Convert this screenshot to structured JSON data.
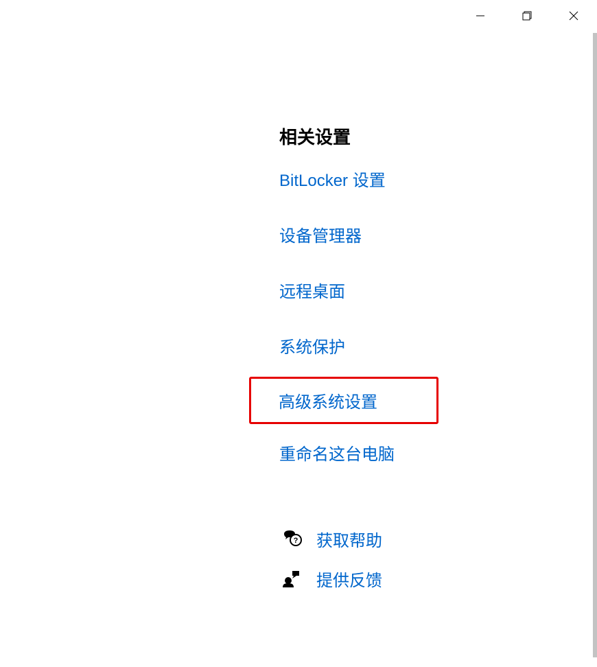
{
  "section": {
    "title": "相关设置",
    "links": [
      {
        "label": "BitLocker 设置"
      },
      {
        "label": "设备管理器"
      },
      {
        "label": "远程桌面"
      },
      {
        "label": "系统保护"
      },
      {
        "label": "高级系统设置"
      },
      {
        "label": "重命名这台电脑"
      }
    ]
  },
  "help": {
    "get_help": "获取帮助",
    "feedback": "提供反馈"
  }
}
